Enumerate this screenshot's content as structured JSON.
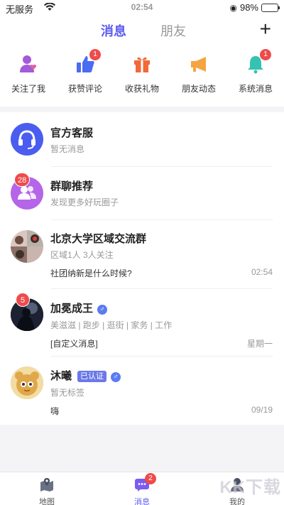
{
  "status_bar": {
    "carrier": "无服务",
    "time": "02:54",
    "battery": "98%"
  },
  "header": {
    "tabs": [
      {
        "label": "消息",
        "active": true
      },
      {
        "label": "朋友",
        "active": false
      }
    ],
    "add_icon": "plus-icon"
  },
  "quick_actions": [
    {
      "label": "关注了我",
      "icon": "person-heart-icon",
      "color": "#a35bd9",
      "badge": ""
    },
    {
      "label": "获赞评论",
      "icon": "thumbs-up-icon",
      "color": "#4a6cf0",
      "badge": "1"
    },
    {
      "label": "收获礼物",
      "icon": "gift-icon",
      "color": "#f06a3a",
      "badge": ""
    },
    {
      "label": "朋友动态",
      "icon": "megaphone-icon",
      "color": "#f5a540",
      "badge": ""
    },
    {
      "label": "系统消息",
      "icon": "bell-icon",
      "color": "#36c2b0",
      "badge": "1"
    }
  ],
  "conversations": [
    {
      "name": "官方客服",
      "subtitle": "暂无消息",
      "message": "",
      "time": "",
      "badge": "",
      "avatar": "headset-icon"
    },
    {
      "name": "群聊推荐",
      "subtitle": "发现更多好玩圈子",
      "message": "",
      "time": "",
      "badge": "28",
      "avatar": "group-icon"
    },
    {
      "name": "北京大学区域交流群",
      "subtitle": "区域1人    3人关注",
      "message": "社团纳新是什么时候?",
      "time": "02:54",
      "badge": ""
    },
    {
      "name": "加冕成王",
      "subtitle": "美滋滋 | 跑步 | 逛街 | 家务 | 工作",
      "message": "[自定义消息]",
      "time": "星期一",
      "badge": "5",
      "gender": "♂"
    },
    {
      "name": "沐曦",
      "verified": "已认证",
      "subtitle": "暂无标签",
      "message": "嗨",
      "time": "09/19",
      "badge": "",
      "gender": "♂"
    }
  ],
  "tabbar": [
    {
      "label": "地图",
      "icon": "map-pin-icon",
      "active": false,
      "badge": ""
    },
    {
      "label": "消息",
      "icon": "chat-icon",
      "active": true,
      "badge": "2"
    },
    {
      "label": "我的",
      "icon": "person-icon",
      "active": false,
      "badge": ""
    }
  ],
  "watermark": "KK下载"
}
